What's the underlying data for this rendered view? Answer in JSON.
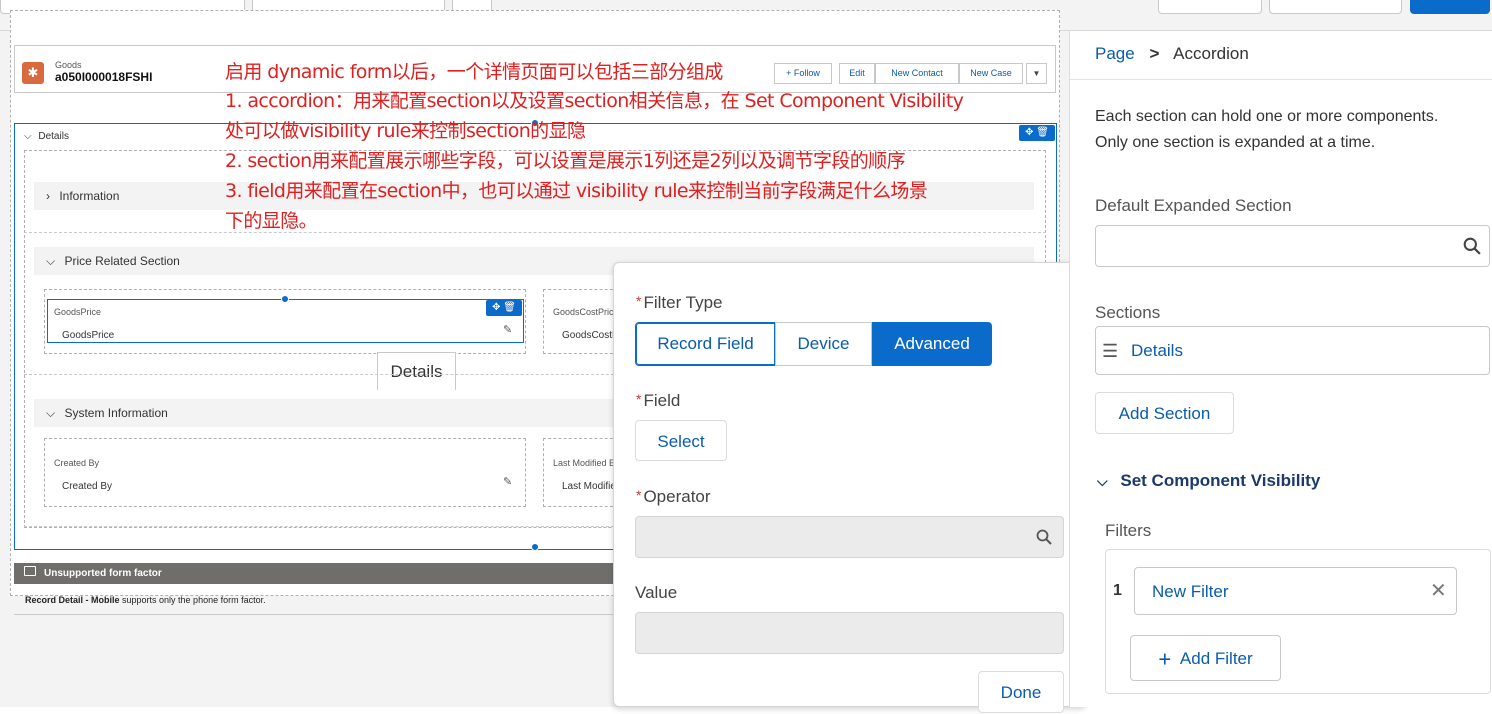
{
  "record": {
    "object_type": "Goods",
    "record_name": "a050I000018FSHI",
    "actions": [
      "Follow",
      "Edit",
      "New Contact",
      "New Case"
    ]
  },
  "details_section": {
    "label": "Details"
  },
  "sections": [
    {
      "label": "Information"
    },
    {
      "label": "Price Related Section",
      "fields": [
        {
          "label": "GoodsPrice",
          "value": "GoodsPrice"
        },
        {
          "label": "GoodsCostPric",
          "value": "GoodsCostP"
        }
      ]
    },
    {
      "label": "System Information",
      "fields": [
        {
          "label": "Created By",
          "value": "Created By"
        },
        {
          "label": "Last Modified B",
          "value": "Last Modifie"
        }
      ]
    }
  ],
  "details_tab": "Details",
  "unsupported": {
    "title": "Unsupported form factor",
    "note_bold": "Record Detail - Mobile",
    "note_rest": " supports only the phone form factor."
  },
  "annotation": [
    "启用 dynamic form以后，一个详情页面可以包括三部分组成",
    "1. accordion：用来配置section以及设置section相关信息，在 Set Component Visibility",
    "处可以做visibility rule来控制section的显隐",
    "2. section用来配置展示哪些字段，可以设置是展示1列还是2列以及调节字段的顺序",
    "3. field用来配置在section中，也可以通过 visibility rule来控制当前字段满足什么场景",
    "下的显隐。"
  ],
  "filter_popover": {
    "filter_type_label": "Filter Type",
    "filter_types": [
      "Record Field",
      "Device",
      "Advanced"
    ],
    "active_filter_type": "Advanced",
    "field_label": "Field",
    "select_button": "Select",
    "operator_label": "Operator",
    "value_label": "Value",
    "done_button": "Done"
  },
  "right_panel": {
    "breadcrumb_parent": "Page",
    "breadcrumb_sep": ">",
    "breadcrumb_current": "Accordion",
    "description_line1": "Each section can hold one or more components.",
    "description_line2": "Only one section is expanded at a time.",
    "default_expanded_label": "Default Expanded Section",
    "sections_label": "Sections",
    "section_item": "Details",
    "add_section_button": "Add Section",
    "visibility_heading": "Set Component Visibility",
    "filters_label": "Filters",
    "filter_index": "1",
    "filter_name": "New Filter",
    "add_filter_button": "Add Filter"
  },
  "colors": {
    "brand_blue": "#0b6bcb",
    "annotation_red": "#e02020",
    "required_red": "#c23934"
  }
}
